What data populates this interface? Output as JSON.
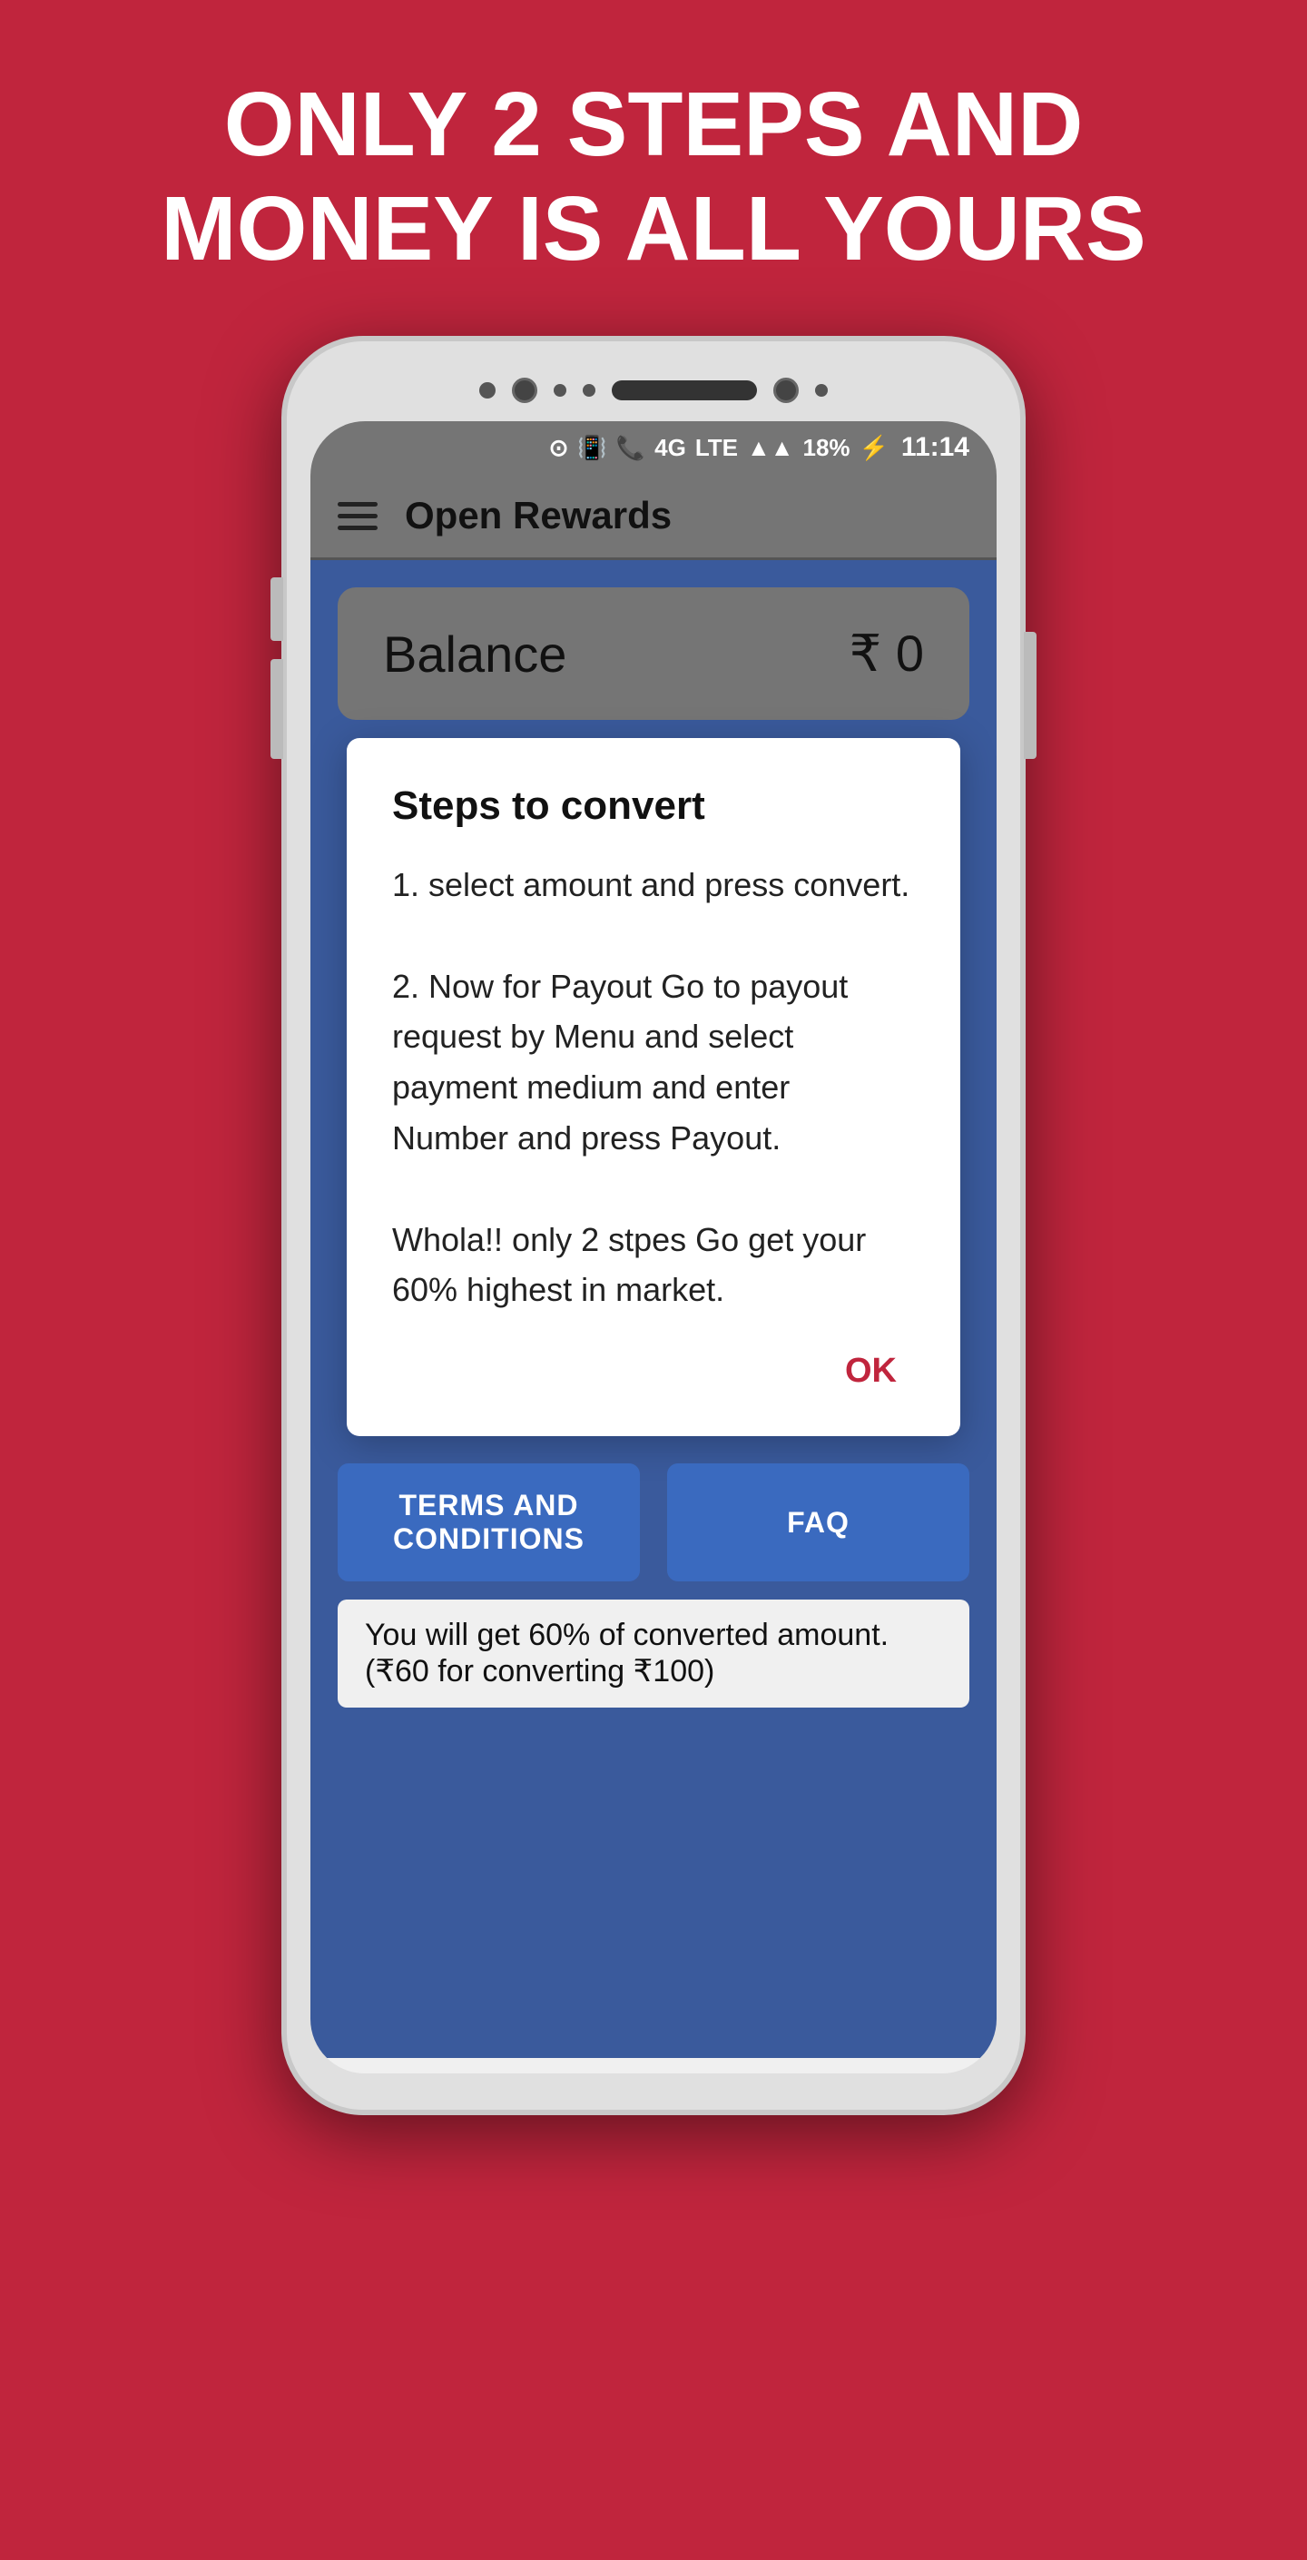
{
  "page": {
    "background_color": "#c0253d",
    "hero_text": "ONLY 2 STEPS AND MONEY IS ALL YOURS"
  },
  "status_bar": {
    "icons_text": "⊙ 📳 📶 4G LTE ▲▲ 18% ⚡",
    "battery": "18%",
    "time": "11:14"
  },
  "app_bar": {
    "title": "Open Rewards",
    "menu_icon": "≡"
  },
  "balance": {
    "label": "Balance",
    "amount": "₹ 0"
  },
  "dialog": {
    "title": "Steps to convert",
    "step1": "1. select amount and press convert.",
    "step2": "2. Now for Payout Go to payout request by Menu and  select payment medium and enter Number and press Payout.",
    "note": "Whola!! only 2 stpes Go get your 60% highest in market.",
    "ok_label": "OK"
  },
  "buttons": {
    "terms": "TERMS AND CONDITIONS",
    "faq": "FAQ"
  },
  "footer_note": "You will get 60% of converted amount.(₹60 for converting ₹100)"
}
